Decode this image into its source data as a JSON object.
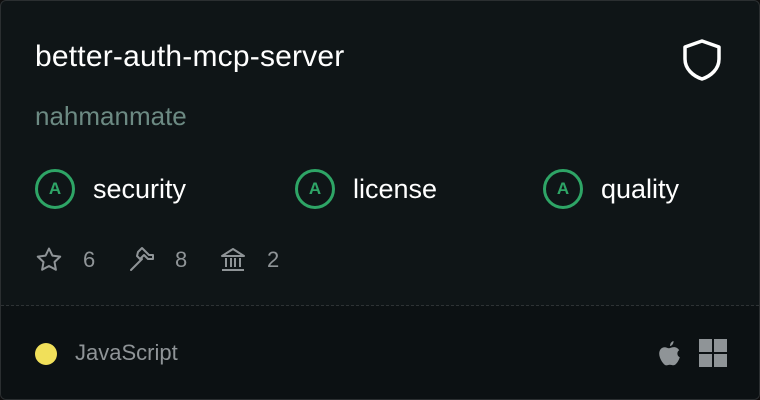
{
  "repo": {
    "name": "better-auth-mcp-server",
    "owner": "nahmanmate"
  },
  "grades": [
    {
      "letter": "A",
      "label": "security"
    },
    {
      "letter": "A",
      "label": "license"
    },
    {
      "letter": "A",
      "label": "quality"
    }
  ],
  "stats": {
    "stars": "6",
    "tools": "8",
    "deployments": "2"
  },
  "footer": {
    "language": "JavaScript",
    "language_color": "#f1e05a",
    "platforms": [
      "apple-icon",
      "windows-icon"
    ]
  },
  "colors": {
    "grade_accent": "#2ea566",
    "background": "#0f1517",
    "muted_text": "#8f9497",
    "owner_text": "#6c8a83"
  }
}
